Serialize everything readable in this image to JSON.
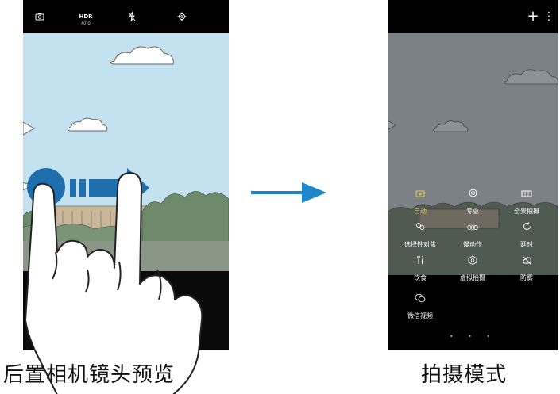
{
  "left_panel": {
    "caption": "后置相机镜头预览",
    "toolbar": {
      "hdr_label": "HDR",
      "hdr_sub": "AUTO",
      "switch_camera_icon": "switch-camera-icon",
      "flash_icon": "flash-off-icon",
      "settings_icon": "gear-icon"
    }
  },
  "right_panel": {
    "caption": "拍摄模式",
    "toolbar": {
      "add_label": "+",
      "more_label": "⋮"
    },
    "modes": [
      {
        "label": "自动",
        "icon": "camera-icon",
        "active": true
      },
      {
        "label": "专业",
        "icon": "aperture-icon",
        "active": false
      },
      {
        "label": "全景拍摄",
        "icon": "panorama-icon",
        "active": false
      },
      {
        "label": "选择性对焦",
        "icon": "focus-icon",
        "active": false
      },
      {
        "label": "慢动作",
        "icon": "slow-motion-icon",
        "active": false
      },
      {
        "label": "延时",
        "icon": "timelapse-icon",
        "active": false
      },
      {
        "label": "饮食",
        "icon": "food-icon",
        "active": false
      },
      {
        "label": "虚拟拍摄",
        "icon": "virtual-shot-icon",
        "active": false
      },
      {
        "label": "防雾",
        "icon": "anti-fog-icon",
        "active": false
      },
      {
        "label": "微信视频",
        "icon": "wechat-video-icon",
        "active": false
      }
    ],
    "page_dots": "• • •"
  },
  "colors": {
    "sky_light": "#c3e1ee",
    "sky_dark": "#7b8185",
    "active_mode": "#e4c84a",
    "arrow_blue": "#1f87c9"
  }
}
